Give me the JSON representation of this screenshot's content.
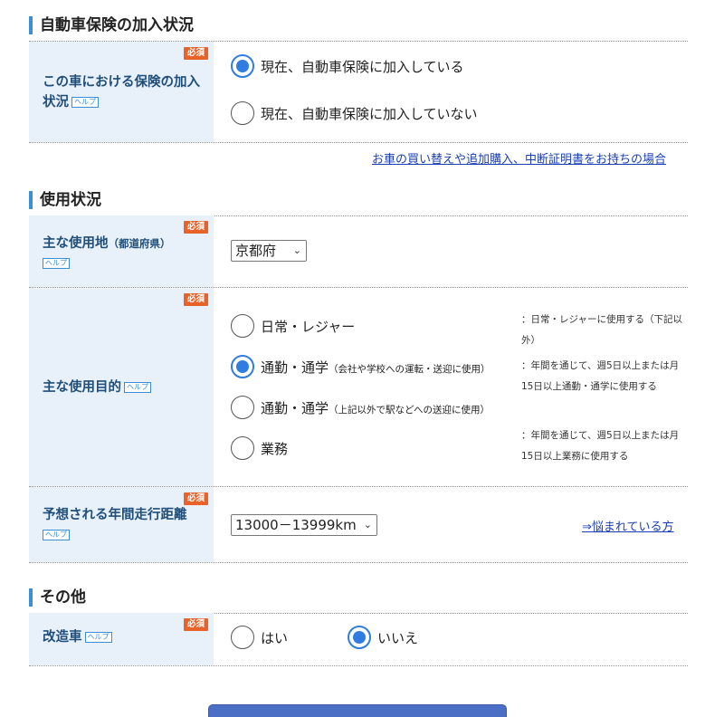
{
  "sections": {
    "insurance_status": "自動車保険の加入状況",
    "usage": "使用状況",
    "other": "その他"
  },
  "badges": {
    "required": "必須",
    "help": "ヘルプ"
  },
  "insurance_row": {
    "label": "この車における保険の加入状況",
    "options": [
      {
        "label": "現在、自動車保険に加入している",
        "checked": true
      },
      {
        "label": "現在、自動車保険に加入していない",
        "checked": false
      }
    ],
    "link": "お車の買い替えや追加購入、中断証明書をお持ちの場合"
  },
  "location_row": {
    "label": "主な使用地",
    "sublabel": "（都道府県）",
    "selected": "京都府"
  },
  "purpose_row": {
    "label": "主な使用目的",
    "options": [
      {
        "label": "日常・レジャー",
        "note": "",
        "checked": false
      },
      {
        "label": "通勤・通学",
        "note": "（会社や学校への運転・送迎に使用）",
        "checked": true
      },
      {
        "label": "通勤・通学",
        "note": "（上記以外で駅などへの送迎に使用）",
        "checked": false
      },
      {
        "label": "業務",
        "note": "",
        "checked": false
      }
    ],
    "descriptions": [
      "：日常・レジャーに使用する（下記以外）",
      "：年間を通じて、週5日以上または月15日以上通勤・通学に使用する",
      "：年間を通じて、週5日以上または月15日以上業務に使用する"
    ]
  },
  "distance_row": {
    "label": "予想される年間走行距離",
    "selected": "13000－13999km",
    "link": "⇒悩まれている方"
  },
  "modified_row": {
    "label": "改造車",
    "options": [
      {
        "label": "はい",
        "checked": false
      },
      {
        "label": "いいえ",
        "checked": true
      }
    ]
  },
  "colors": {
    "accent": "#3b8fd6",
    "label_bg": "#e8f1fa",
    "required": "#e8622a",
    "radio_checked": "#2f7de1",
    "link": "#1a3fb4",
    "button": "#4b6fc4"
  },
  "icons": {
    "select_arrow": "chevron-down-icon"
  }
}
